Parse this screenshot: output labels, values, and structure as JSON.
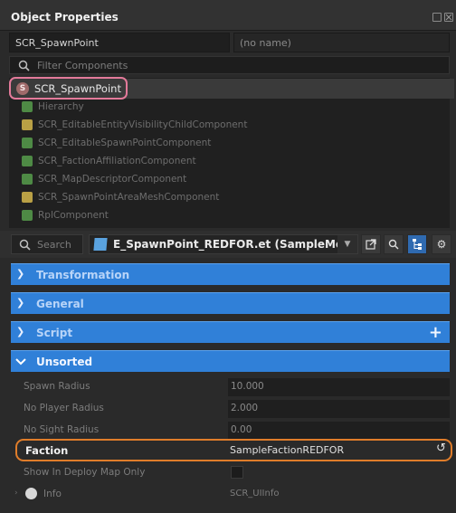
{
  "window": {
    "title": "Object Properties"
  },
  "name_fields": {
    "class_name": "SCR_SpawnPoint",
    "object_name_placeholder": "(no name)"
  },
  "filter": {
    "placeholder": "Filter Components"
  },
  "tree": {
    "root": {
      "label": "SCR_SpawnPoint",
      "icon": "script-s-icon"
    },
    "items": [
      {
        "label": "Hierarchy",
        "icon": "component-green-icon"
      },
      {
        "label": "SCR_EditableEntityVisibilityChildComponent",
        "icon": "script-yellow-icon"
      },
      {
        "label": "SCR_EditableSpawnPointComponent",
        "icon": "component-green-icon"
      },
      {
        "label": "SCR_FactionAffiliationComponent",
        "icon": "component-green-icon"
      },
      {
        "label": "SCR_MapDescriptorComponent",
        "icon": "component-green-icon"
      },
      {
        "label": "SCR_SpawnPointAreaMeshComponent",
        "icon": "script-yellow-icon"
      },
      {
        "label": "RplComponent",
        "icon": "component-green-icon"
      }
    ]
  },
  "toolbar": {
    "search_placeholder": "Search",
    "entity_label": "E_SpawnPoint_REDFOR.et (SampleMod",
    "dropdown_glyph": "▼"
  },
  "categories": {
    "transformation": "Transformation",
    "general": "General",
    "script": "Script",
    "unsorted": "Unsorted",
    "plus_glyph": "+"
  },
  "properties": [
    {
      "label": "Spawn Radius",
      "value": "10.000"
    },
    {
      "label": "No Player Radius",
      "value": "2.000"
    },
    {
      "label": "No Sight Radius",
      "value": "0.00"
    }
  ],
  "faction": {
    "label": "Faction",
    "value": "SampleFactionREDFOR"
  },
  "deploy": {
    "label": "Show In Deploy Map Only"
  },
  "info": {
    "label": "Info",
    "value": "SCR_UIInfo"
  },
  "colors": {
    "accent": "#3080d8",
    "root_highlight": "#e37a9a",
    "faction_highlight": "#e07d2a"
  }
}
